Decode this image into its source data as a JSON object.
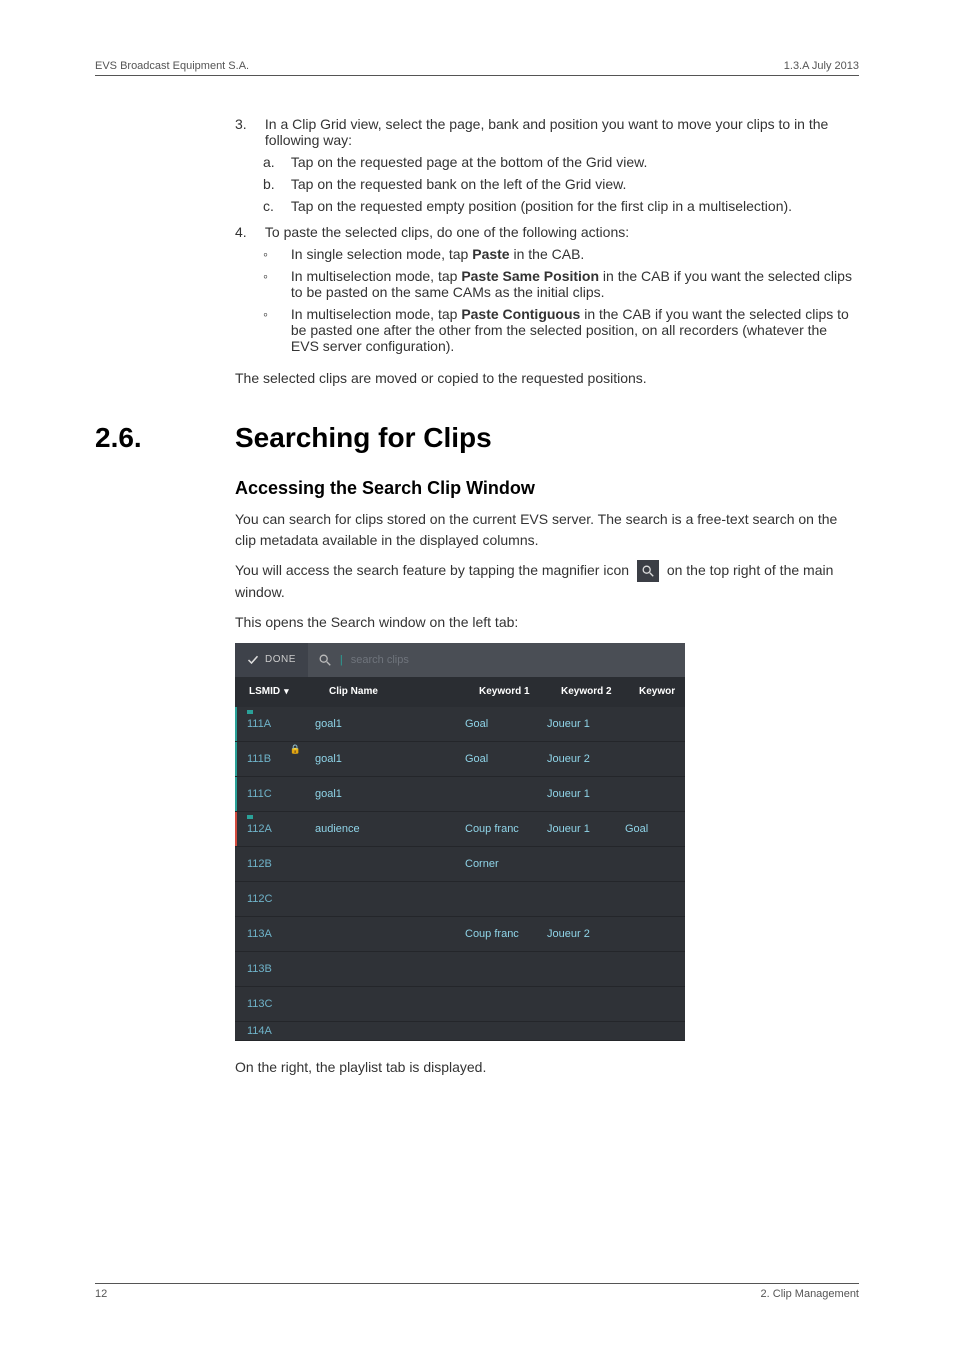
{
  "header": {
    "left": "EVS Broadcast Equipment S.A.",
    "right": "1.3.A  July 2013"
  },
  "ol3": {
    "num": "3.",
    "lead": "In a Clip Grid view, select the page, bank and position you want to move your clips to in the following way:",
    "a": {
      "num": "a.",
      "text": "Tap on the requested page at the bottom of the Grid view."
    },
    "b": {
      "num": "b.",
      "text": "Tap on the requested bank on the left of the Grid view."
    },
    "c": {
      "num": "c.",
      "text": "Tap on the requested empty position (position for the first clip in a multiselection)."
    }
  },
  "ol4": {
    "num": "4.",
    "lead": "To paste the selected clips, do one of the following actions:",
    "b1a": "In single selection mode, tap ",
    "b1_bold": "Paste",
    "b1b": " in the CAB.",
    "b2a": "In multiselection mode, tap ",
    "b2_bold": "Paste Same Position",
    "b2b": " in the CAB if you want the selected clips to be pasted on the same CAMs as the initial clips.",
    "b3a": "In multiselection mode, tap ",
    "b3_bold": "Paste Contiguous",
    "b3b": " in the CAB if you want the selected clips to be pasted one after the other from the selected position, on all recorders (whatever the EVS server configuration)."
  },
  "ol_after": "The selected clips are moved or copied to the requested positions.",
  "section": {
    "num": "2.6.",
    "title": "Searching for Clips"
  },
  "sub1": "Accessing the Search Clip Window",
  "p1": "You can search for clips stored on the current EVS server. The search is a free-text search on the clip metadata available in the displayed columns.",
  "p2a": "You will access the search feature by tapping the magnifier icon ",
  "p2b": " on the top right of the main window.",
  "p3": "This opens the Search window on the left tab:",
  "search": {
    "done": "DONE",
    "placeholder": "search clips",
    "cols": {
      "lsmid": "LSMID",
      "clip": "Clip Name",
      "k1": "Keyword 1",
      "k2": "Keyword 2",
      "k3": "Keywor"
    },
    "rows": [
      {
        "lsmid": "111A",
        "clip": "goal1",
        "k1": "Goal",
        "k2": "Joueur 1",
        "k3": "",
        "bar": "teal",
        "flag": true,
        "lock": false
      },
      {
        "lsmid": "111B",
        "clip": "goal1",
        "k1": "Goal",
        "k2": "Joueur 2",
        "k3": "",
        "bar": "teal",
        "flag": false,
        "lock": true
      },
      {
        "lsmid": "111C",
        "clip": "goal1",
        "k1": "",
        "k2": "Joueur 1",
        "k3": "",
        "bar": "teal",
        "flag": false,
        "lock": false
      },
      {
        "lsmid": "112A",
        "clip": "audience",
        "k1": "Coup franc",
        "k2": "Joueur 1",
        "k3": "Goal",
        "bar": "red",
        "flag": true,
        "lock": false
      },
      {
        "lsmid": "112B",
        "clip": "",
        "k1": "Corner",
        "k2": "",
        "k3": "",
        "bar": "none",
        "flag": false,
        "lock": false
      },
      {
        "lsmid": "112C",
        "clip": "",
        "k1": "",
        "k2": "",
        "k3": "",
        "bar": "none",
        "flag": false,
        "lock": false
      },
      {
        "lsmid": "113A",
        "clip": "",
        "k1": "Coup franc",
        "k2": "Joueur 2",
        "k3": "",
        "bar": "none",
        "flag": false,
        "lock": false
      },
      {
        "lsmid": "113B",
        "clip": "",
        "k1": "",
        "k2": "",
        "k3": "",
        "bar": "none",
        "flag": false,
        "lock": false
      },
      {
        "lsmid": "113C",
        "clip": "",
        "k1": "",
        "k2": "",
        "k3": "",
        "bar": "none",
        "flag": false,
        "lock": false
      },
      {
        "lsmid": "114A",
        "clip": "",
        "k1": "",
        "k2": "",
        "k3": "",
        "bar": "none",
        "flag": false,
        "lock": false
      }
    ]
  },
  "p4": "On the right, the playlist tab is displayed.",
  "footer": {
    "left": "12",
    "right": "2. Clip Management"
  }
}
